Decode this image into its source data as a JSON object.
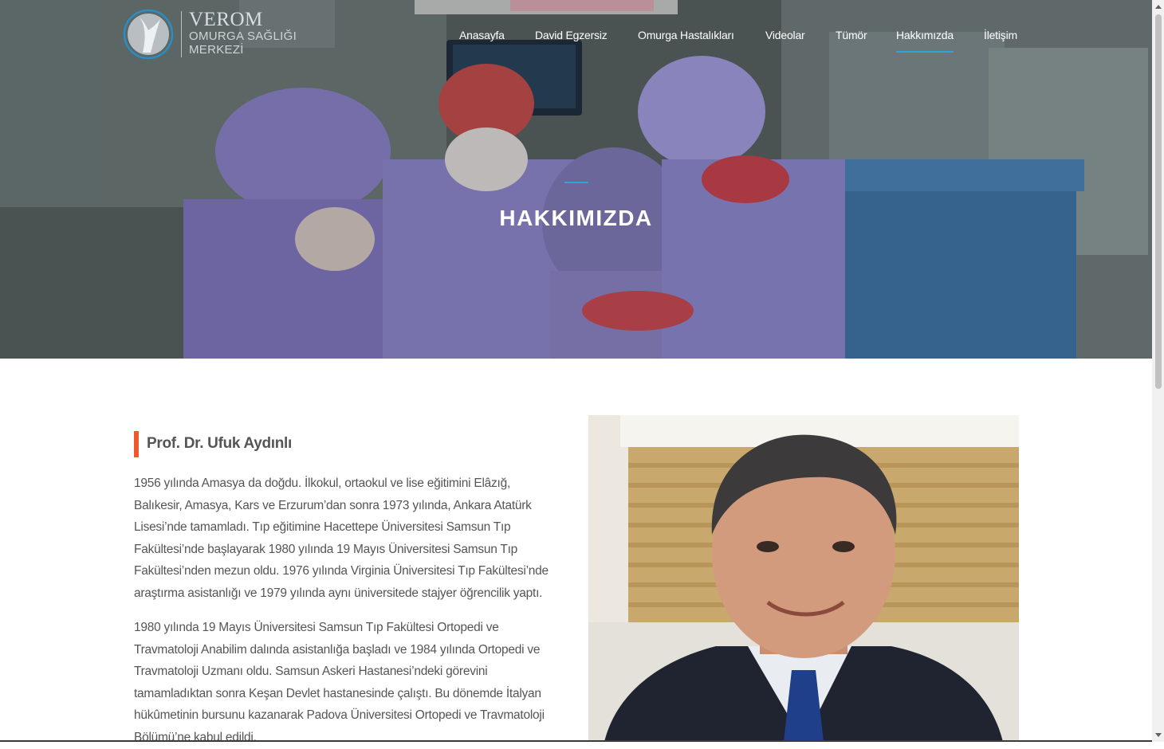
{
  "logo": {
    "brand": "VEROM",
    "line1": "OMURGA SAĞLIĞI",
    "line2": "MERKEZİ"
  },
  "nav": {
    "items": [
      {
        "label": "Anasayfa",
        "active": false
      },
      {
        "label": "David Egzersiz",
        "active": false
      },
      {
        "label": "Omurga Hastalıkları",
        "active": false
      },
      {
        "label": "Videolar",
        "active": false
      },
      {
        "label": "Tümör",
        "active": false
      },
      {
        "label": "Hakkımızda",
        "active": true
      },
      {
        "label": "İletişim",
        "active": false
      }
    ]
  },
  "hero": {
    "title": "HAKKIMIZDA"
  },
  "profile": {
    "name": "Prof. Dr. Ufuk Aydınlı",
    "paragraphs": [
      "1956 yılında Amasya da doğdu. İlkokul, ortaokul ve lise eğitimini Elâzığ, Balıkesir, Amasya, Kars ve Erzurum’dan sonra 1973 yılında, Ankara Atatürk Lisesi’nde tamamladı. Tıp eğitimine Hacettepe Üniversitesi Samsun Tıp Fakültesi’nde başlayarak 1980 yılında 19 Mayıs Üniversitesi Samsun Tıp Fakültesi’nden mezun oldu. 1976 yılında Virginia Üniversitesi Tıp Fakültesi’nde araştırma asistanlığı ve 1979 yılında aynı üniversitede stajyer öğrencilik yaptı.",
      "1980 yılında 19 Mayıs Üniversitesi Samsun Tıp Fakültesi Ortopedi ve Travmatoloji Anabilim dalında asistanlığa başladı ve 1984 yılında Ortopedi ve Travmatoloji Uzmanı oldu. Samsun Askeri Hastanesi’ndeki görevini tamamladıktan sonra Keşan Devlet hastanesinde çalıştı. Bu dönemde İtalyan hükûmetinin bursunu kazanarak Padova Üniversitesi Ortopedi ve Travmatoloji Bölümü’ne kabul edildi."
    ]
  },
  "colors": {
    "accent_blue": "#2aa6d8",
    "accent_orange": "#ee5a2b",
    "text": "#555555"
  }
}
